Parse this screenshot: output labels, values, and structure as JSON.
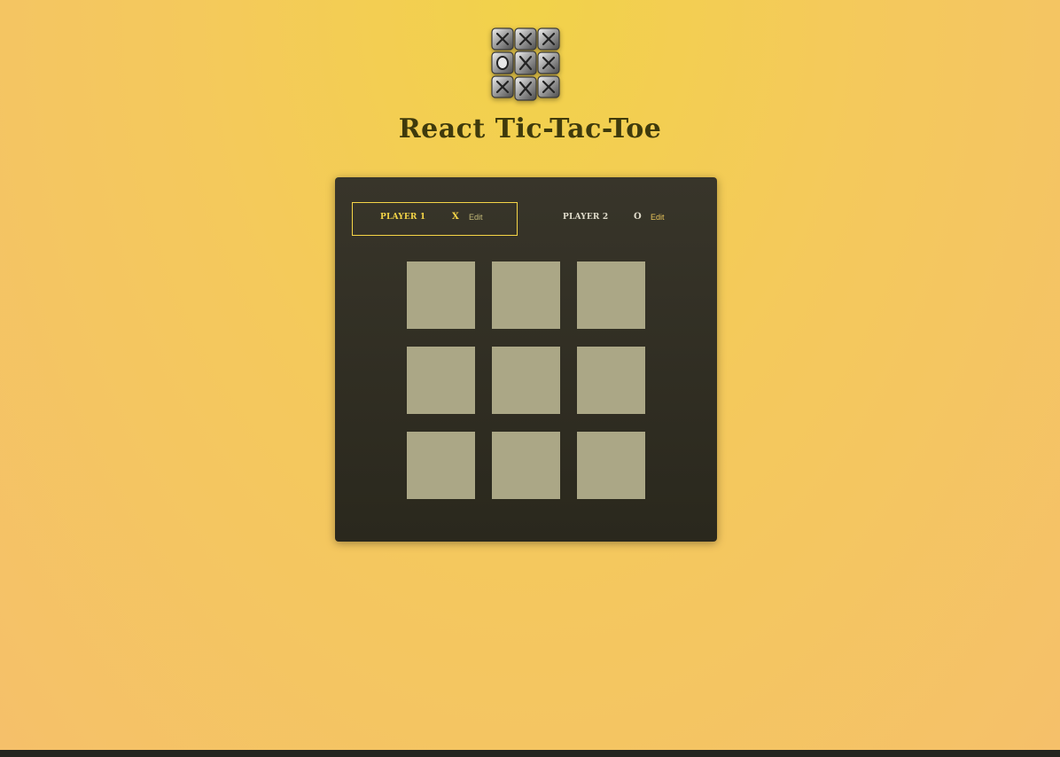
{
  "header": {
    "logo_icon": "tic-tac-toe-grid-logo-icon",
    "title": "React Tic-Tac-Toe"
  },
  "players": [
    {
      "name": "Player 1",
      "symbol": "X",
      "edit_label": "Edit",
      "active": true
    },
    {
      "name": "Player 2",
      "symbol": "O",
      "edit_label": "Edit",
      "active": false
    }
  ],
  "board": {
    "rows": [
      [
        "",
        "",
        ""
      ],
      [
        "",
        "",
        ""
      ],
      [
        "",
        "",
        ""
      ]
    ]
  },
  "colors": {
    "accent": "#f5d547",
    "panel": "#2f2d22",
    "cell": "#aba786",
    "title": "#3f3a0c"
  }
}
